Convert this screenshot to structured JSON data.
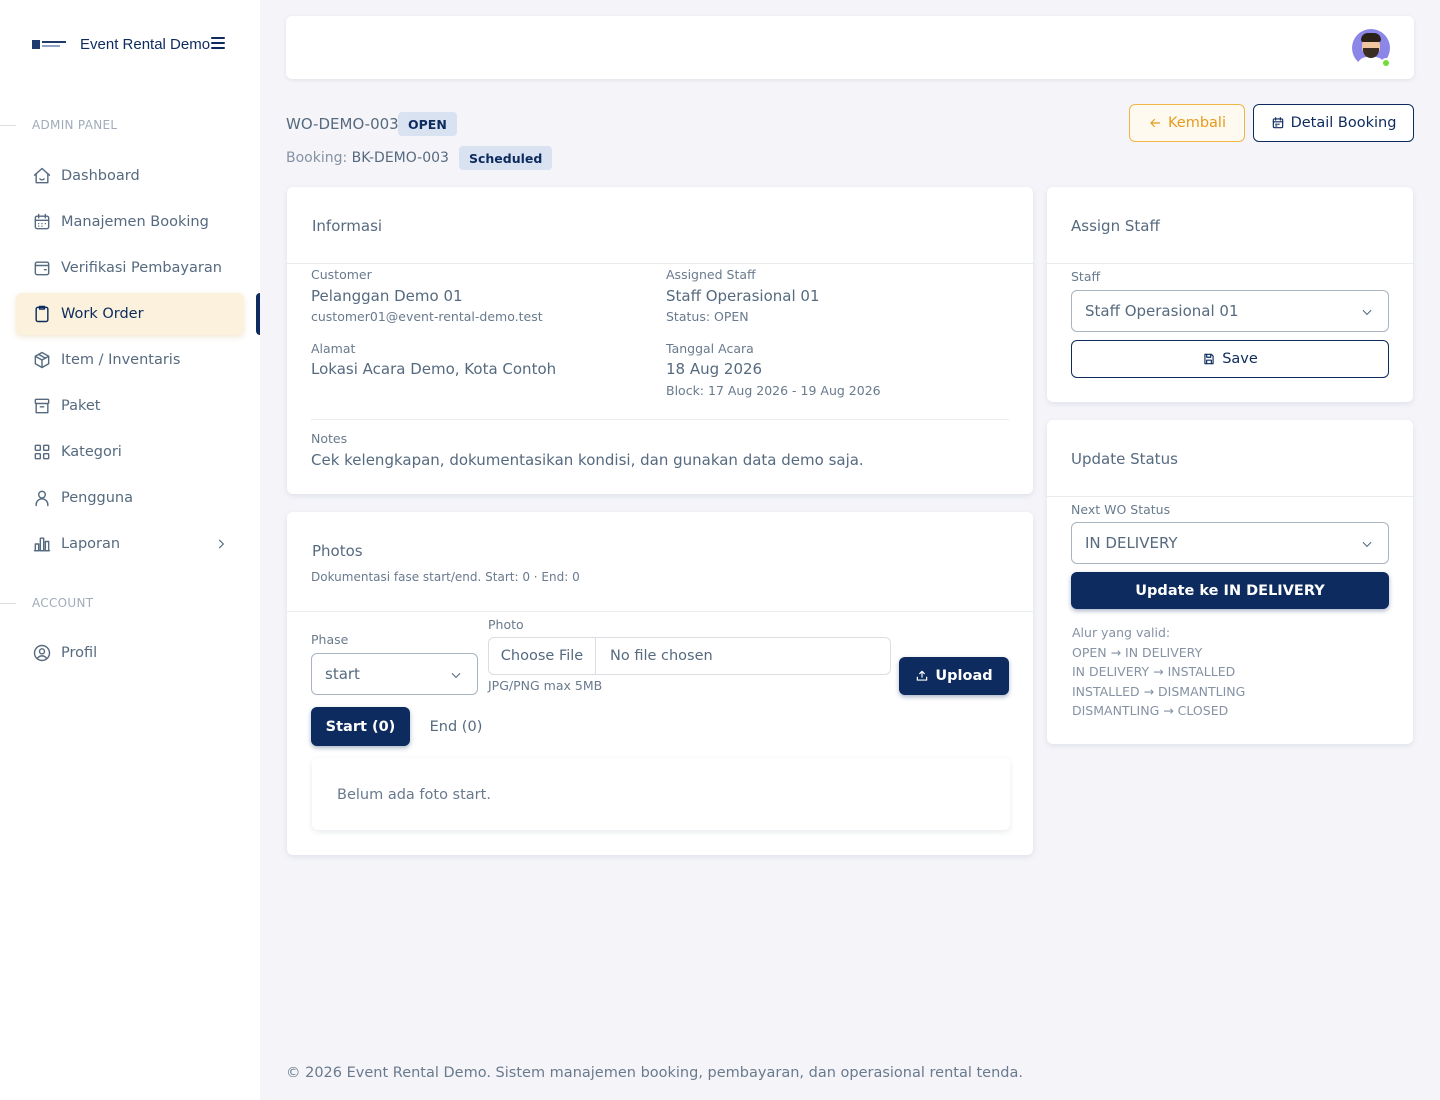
{
  "brand": {
    "name": "Event Rental Demo"
  },
  "sidebar": {
    "section_admin": "ADMIN PANEL",
    "section_account": "ACCOUNT",
    "items": [
      {
        "label": "Dashboard",
        "icon": "home-icon"
      },
      {
        "label": "Manajemen Booking",
        "icon": "calendar-icon"
      },
      {
        "label": "Verifikasi Pembayaran",
        "icon": "wallet-icon"
      },
      {
        "label": "Work Order",
        "icon": "clipboard-icon",
        "active": true
      },
      {
        "label": "Item / Inventaris",
        "icon": "box-icon"
      },
      {
        "label": "Paket",
        "icon": "archive-icon"
      },
      {
        "label": "Kategori",
        "icon": "grid-icon"
      },
      {
        "label": "Pengguna",
        "icon": "user-icon"
      },
      {
        "label": "Laporan",
        "icon": "chart-icon"
      }
    ],
    "account_items": [
      {
        "label": "Profil",
        "icon": "user-circle-icon"
      }
    ]
  },
  "header": {
    "wo_code": "WO-DEMO-003",
    "wo_status": "OPEN",
    "booking_prefix": "Booking:",
    "booking_code": "BK-DEMO-003",
    "booking_status": "Scheduled",
    "back_label": "Kembali",
    "detail_label": "Detail Booking"
  },
  "info": {
    "title": "Informasi",
    "customer_label": "Customer",
    "customer_name": "Pelanggan Demo 01",
    "customer_email": "customer01@event-rental-demo.test",
    "address_label": "Alamat",
    "address": "Lokasi Acara Demo, Kota Contoh",
    "staff_label": "Assigned Staff",
    "staff_name": "Staff Operasional 01",
    "staff_status": "Status: OPEN",
    "date_label": "Tanggal Acara",
    "date": "18 Aug 2026",
    "block": "Block: 17 Aug 2026 - 19 Aug 2026",
    "notes_label": "Notes",
    "notes": "Cek kelengkapan, dokumentasikan kondisi, dan gunakan data demo saja."
  },
  "photos": {
    "title": "Photos",
    "subtitle": "Dokumentasi fase start/end. Start: 0 · End: 0",
    "phase_label": "Phase",
    "phase_value": "start",
    "photo_label": "Photo",
    "choose_file": "Choose File",
    "no_file": "No file chosen",
    "hint": "JPG/PNG max 5MB",
    "upload_label": "Upload",
    "tab_start": "Start (0)",
    "tab_end": "End (0)",
    "empty": "Belum ada foto start."
  },
  "assign": {
    "title": "Assign Staff",
    "staff_label": "Staff",
    "staff_value": "Staff Operasional 01",
    "save_label": "Save"
  },
  "status": {
    "title": "Update Status",
    "next_label": "Next WO Status",
    "next_value": "IN DELIVERY",
    "update_label": "Update ke IN DELIVERY",
    "flow_title": "Alur yang valid:",
    "flow": [
      "OPEN → IN DELIVERY",
      "IN DELIVERY → INSTALLED",
      "INSTALLED → DISMANTLING",
      "DISMANTLING → CLOSED"
    ]
  },
  "footer": {
    "text": "© 2026 Event Rental Demo. Sistem manajemen booking, pembayaran, dan operasional rental tenda."
  },
  "colors": {
    "primary": "#0d2b5e",
    "accent": "#e59b1c",
    "active_bg": "#fbf1dc",
    "online": "#71dd37"
  }
}
